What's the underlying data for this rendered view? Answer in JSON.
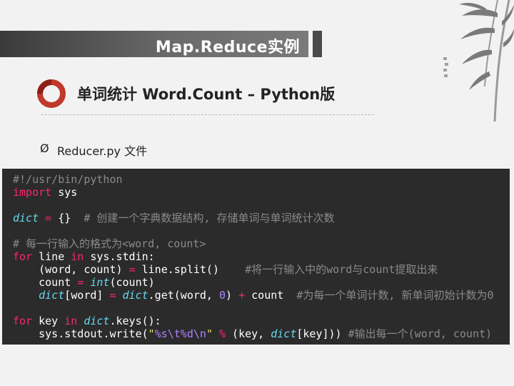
{
  "header": {
    "title": "Map.Reduce实例"
  },
  "section": {
    "subtitle": "单词统计 Word.Count – Python版"
  },
  "bullet": {
    "marker": "Ø",
    "label": "Reducer.py 文件"
  },
  "code_lines": [
    "#!/usr/bin/python",
    "import sys",
    "",
    "dict = {}  # 创建一个字典数据结构, 存储单词与单词统计次数",
    "",
    "# 每一行输入的格式为<word, count>",
    "for line in sys.stdin:",
    "    (word, count) = line.split()    #将一行输入中的word与count提取出来",
    "    count = int(count)",
    "    dict[word] = dict.get(word, 0) + count  #为每一个单词计数, 新单词初始计数为0",
    "",
    "for key in dict.keys():",
    "    sys.stdout.write(\"%s\\t%d\\n\" % (key, dict[key])) #输出每一个(word, count)"
  ],
  "colors": {
    "code_background": "#2b2b2b",
    "keyword": "#f92672",
    "builtin": "#66d9ef",
    "number": "#ae81ff",
    "string": "#e6db74",
    "comment": "#8a8a8a",
    "logo_accent": "#c0392b"
  },
  "icons": {
    "logo": "red-ring-logo",
    "decoration": "bamboo-ink-painting"
  }
}
